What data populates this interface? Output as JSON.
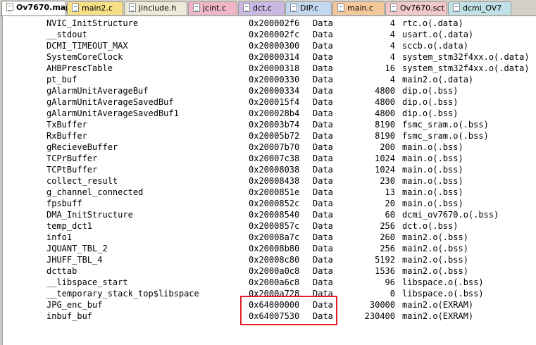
{
  "tabs": [
    {
      "label": "Ov7670.map",
      "active": true,
      "color": "#ffffff"
    },
    {
      "label": "main2.c",
      "active": false,
      "color": "#f6df86"
    },
    {
      "label": "jinclude.h",
      "active": false,
      "color": "#ece9d8"
    },
    {
      "label": "jcint.c",
      "active": false,
      "color": "#efb6c8"
    },
    {
      "label": "dct.c",
      "active": false,
      "color": "#c9b8e2"
    },
    {
      "label": "DIP.c",
      "active": false,
      "color": "#c3d7ee"
    },
    {
      "label": "main.c",
      "active": false,
      "color": "#f4c99a"
    },
    {
      "label": "Ov7670.sct",
      "active": false,
      "color": "#f2c7c7"
    },
    {
      "label": "dcmi_OV7",
      "active": false,
      "color": "#bfe0e6"
    }
  ],
  "symbols": [
    {
      "name": "NVIC_InitStructure",
      "addr": "0x200002f6",
      "type": "Data",
      "size": "4",
      "object": "rtc.o(.data)"
    },
    {
      "name": "__stdout",
      "addr": "0x200002fc",
      "type": "Data",
      "size": "4",
      "object": "usart.o(.data)"
    },
    {
      "name": "DCMI_TIMEOUT_MAX",
      "addr": "0x20000300",
      "type": "Data",
      "size": "4",
      "object": "sccb.o(.data)"
    },
    {
      "name": "SystemCoreClock",
      "addr": "0x20000314",
      "type": "Data",
      "size": "4",
      "object": "system_stm32f4xx.o(.data)"
    },
    {
      "name": "AHBPrescTable",
      "addr": "0x20000318",
      "type": "Data",
      "size": "16",
      "object": "system_stm32f4xx.o(.data)"
    },
    {
      "name": "pt_buf",
      "addr": "0x20000330",
      "type": "Data",
      "size": "4",
      "object": "main2.o(.data)"
    },
    {
      "name": "gAlarmUnitAverageBuf",
      "addr": "0x20000334",
      "type": "Data",
      "size": "4800",
      "object": "dip.o(.bss)"
    },
    {
      "name": "gAlarmUnitAverageSavedBuf",
      "addr": "0x200015f4",
      "type": "Data",
      "size": "4800",
      "object": "dip.o(.bss)"
    },
    {
      "name": "gAlarmUnitAverageSavedBuf1",
      "addr": "0x200028b4",
      "type": "Data",
      "size": "4800",
      "object": "dip.o(.bss)"
    },
    {
      "name": "TxBuffer",
      "addr": "0x20003b74",
      "type": "Data",
      "size": "8190",
      "object": "fsmc_sram.o(.bss)"
    },
    {
      "name": "RxBuffer",
      "addr": "0x20005b72",
      "type": "Data",
      "size": "8190",
      "object": "fsmc_sram.o(.bss)"
    },
    {
      "name": "gRecieveBuffer",
      "addr": "0x20007b70",
      "type": "Data",
      "size": "200",
      "object": "main.o(.bss)"
    },
    {
      "name": "TCPrBuffer",
      "addr": "0x20007c38",
      "type": "Data",
      "size": "1024",
      "object": "main.o(.bss)"
    },
    {
      "name": "TCPtBuffer",
      "addr": "0x20008038",
      "type": "Data",
      "size": "1024",
      "object": "main.o(.bss)"
    },
    {
      "name": "collect_result",
      "addr": "0x20008438",
      "type": "Data",
      "size": "230",
      "object": "main.o(.bss)"
    },
    {
      "name": "g_channel_connected",
      "addr": "0x2000851e",
      "type": "Data",
      "size": "13",
      "object": "main.o(.bss)"
    },
    {
      "name": "fpsbuff",
      "addr": "0x2000852c",
      "type": "Data",
      "size": "20",
      "object": "main.o(.bss)"
    },
    {
      "name": "DMA_InitStructure",
      "addr": "0x20008540",
      "type": "Data",
      "size": "60",
      "object": "dcmi_ov7670.o(.bss)"
    },
    {
      "name": "temp_dct1",
      "addr": "0x2000857c",
      "type": "Data",
      "size": "256",
      "object": "dct.o(.bss)"
    },
    {
      "name": "info1",
      "addr": "0x20008a7c",
      "type": "Data",
      "size": "260",
      "object": "main2.o(.bss)"
    },
    {
      "name": "JQUANT_TBL_2",
      "addr": "0x20008b80",
      "type": "Data",
      "size": "256",
      "object": "main2.o(.bss)"
    },
    {
      "name": "JHUFF_TBL_4",
      "addr": "0x20008c80",
      "type": "Data",
      "size": "5192",
      "object": "main2.o(.bss)"
    },
    {
      "name": "dcttab",
      "addr": "0x2000a0c8",
      "type": "Data",
      "size": "1536",
      "object": "main2.o(.bss)"
    },
    {
      "name": "__libspace_start",
      "addr": "0x2000a6c8",
      "type": "Data",
      "size": "96",
      "object": "libspace.o(.bss)"
    },
    {
      "name": "__temporary_stack_top$libspace",
      "addr": "0x2000a728",
      "type": "Data",
      "size": "0",
      "object": "libspace.o(.bss)"
    },
    {
      "name": "JPG_enc_buf",
      "addr": "0x64000000",
      "type": "Data",
      "size": "30000",
      "object": "main2.o(EXRAM)"
    },
    {
      "name": "inbuf_buf",
      "addr": "0x64007530",
      "type": "Data",
      "size": "230400",
      "object": " main2.o(EXRAM)"
    }
  ],
  "highlight_color": "#e01f26"
}
